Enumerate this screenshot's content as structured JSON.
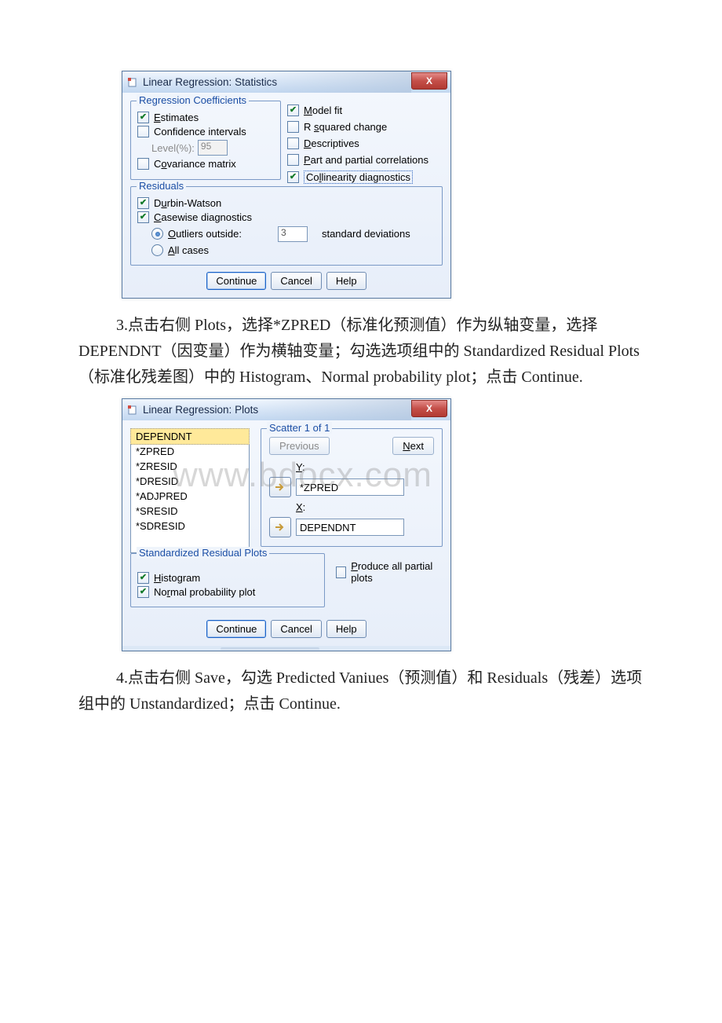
{
  "watermark": "www.bdocx.com",
  "dialog1": {
    "title": "Linear Regression: Statistics",
    "close": "X",
    "groups": {
      "reg_coef": {
        "title": "Regression Coefficients",
        "estimates": "Estimates",
        "confidence": "Confidence intervals",
        "level_label": "Level(%):",
        "level_value": "95",
        "covariance": "Covariance matrix"
      },
      "right": {
        "model_fit": "Model fit",
        "rsq": "R squared change",
        "descriptives": "Descriptives",
        "part": "Part and partial correlations",
        "collinearity": "Collinearity diagnostics"
      },
      "residuals": {
        "title": "Residuals",
        "durbin": "Durbin-Watson",
        "casewise": "Casewise diagnostics",
        "outliers": "Outliers outside:",
        "outliers_val": "3",
        "stddev": "standard deviations",
        "allcases": "All cases"
      }
    },
    "buttons": {
      "continue": "Continue",
      "cancel": "Cancel",
      "help": "Help"
    }
  },
  "para3": "3.点击右侧 Plots，选择*ZPRED（标准化预测值）作为纵轴变量，选择 DEPENDNT（因变量）作为横轴变量；勾选选项组中的 Standardized Residual Plots（标准化残差图）中的 Histogram、Normal probability plot；点击 Continue.",
  "dialog2": {
    "title": "Linear Regression: Plots",
    "close": "X",
    "list": [
      "DEPENDNT",
      "*ZPRED",
      "*ZRESID",
      "*DRESID",
      "*ADJPRED",
      "*SRESID",
      "*SDRESID"
    ],
    "scatter_title": "Scatter 1 of 1",
    "prev": "Previous",
    "next": "Next",
    "ylabel": "Y:",
    "yval": "*ZPRED",
    "xlabel": "X:",
    "xval": "DEPENDNT",
    "srp_title": "Standardized Residual Plots",
    "histogram": "Histogram",
    "normal": "Normal probability plot",
    "produce": "Produce all partial plots",
    "buttons": {
      "continue": "Continue",
      "cancel": "Cancel",
      "help": "Help"
    }
  },
  "para4": "4.点击右侧 Save，勾选 Predicted Vaniues（预测值）和 Residuals（残差）选项组中的 Unstandardized；点击 Continue."
}
